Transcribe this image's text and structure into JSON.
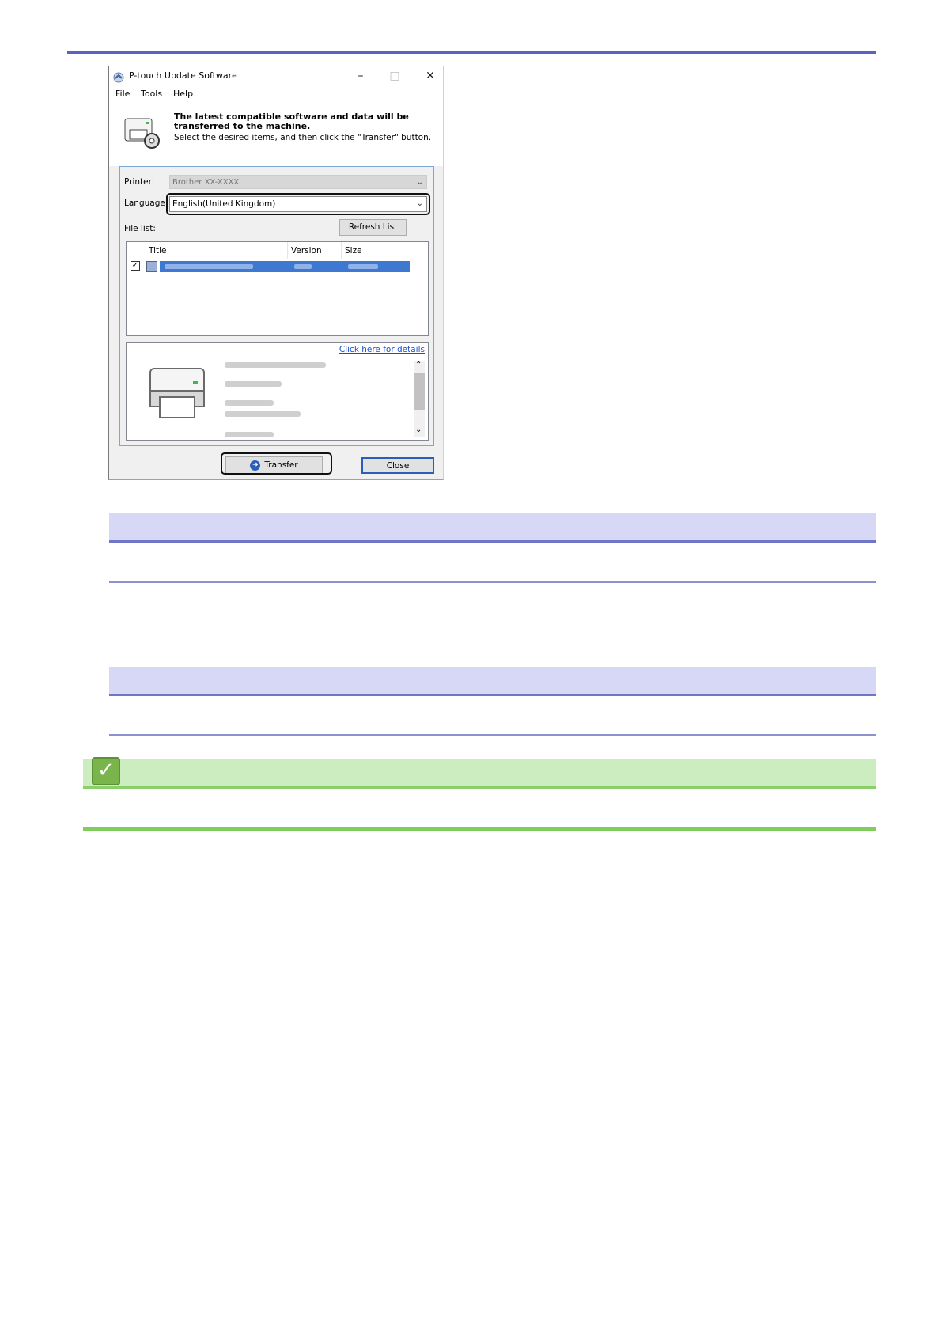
{
  "window": {
    "title": "P-touch Update Software",
    "controls": {
      "minimize": "–",
      "maximize": "□",
      "close": "✕"
    }
  },
  "menu": [
    "File",
    "Tools",
    "Help"
  ],
  "header": {
    "bold_text": "The latest compatible software and data will be transferred to the machine.",
    "instruction": "Select the desired items, and then click the \"Transfer\" button."
  },
  "printer": {
    "label": "Printer:",
    "value": "Brother  XX-XXXX"
  },
  "language": {
    "label": "Language:",
    "value": "English(United Kingdom)"
  },
  "file_list": {
    "label": "File list:",
    "refresh_button": "Refresh List",
    "columns": [
      "Title",
      "Version",
      "Size"
    ],
    "checkbox_mark": "✓"
  },
  "details": {
    "link": "Click here for details"
  },
  "buttons": {
    "transfer": "Transfer",
    "close": "Close"
  },
  "note": {
    "icon": "checkmark-icon",
    "icon_glyph": "✓",
    "accent": "#79b54b"
  },
  "colors": {
    "rule": "#5b62c2",
    "band": "#d6d8f5",
    "green_band": "#ccedbf"
  }
}
